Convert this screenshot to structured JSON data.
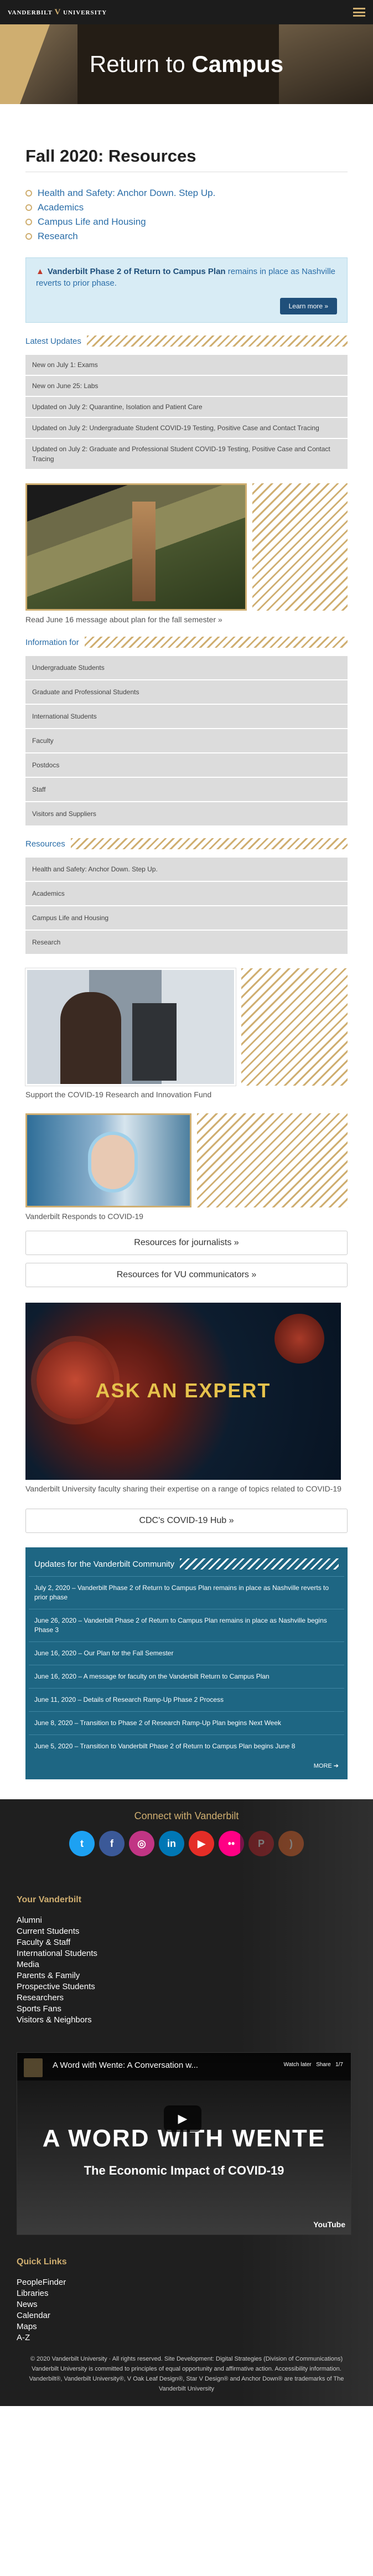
{
  "header": {
    "logo_word1": "VANDERBILT",
    "logo_mark": "V",
    "logo_word2": "UNIVERSITY",
    "menu_icon": "hamburger-icon"
  },
  "hero": {
    "title_light": "Return to",
    "title_bold": "Campus"
  },
  "page": {
    "title": "Fall 2020: Resources"
  },
  "resource_links": [
    "Health and Safety: Anchor Down. Step Up.",
    "Academics",
    "Campus Life and Housing",
    "Research"
  ],
  "alert": {
    "bold": "Vanderbilt Phase 2 of Return to Campus Plan",
    "text": " remains in place as Nashville reverts to prior phase.",
    "button": "Learn more »"
  },
  "latest": {
    "heading": "Latest Updates",
    "items": [
      "New on July 1: Exams",
      "New on June 25: Labs",
      "Updated on July 2: Quarantine, Isolation and Patient Care",
      "Updated on July 2: Undergraduate Student COVID-19 Testing, Positive Case and Contact Tracing",
      "Updated on July 2: Graduate and Professional Student COVID-19 Testing, Positive Case and Contact Tracing"
    ]
  },
  "feature1": {
    "caption": "Read June 16 message about plan for the fall semester »"
  },
  "info": {
    "heading": "Information for",
    "items": [
      "Undergraduate Students",
      "Graduate and Professional Students",
      "International Students",
      "Faculty",
      "Postdocs",
      "Staff",
      "Visitors and Suppliers"
    ]
  },
  "resources": {
    "heading": "Resources",
    "items": [
      "Health and Safety: Anchor Down. Step Up.",
      "Academics",
      "Campus Life and Housing",
      "Research"
    ]
  },
  "feature2": {
    "caption": "Support the COVID-19 Research and Innovation Fund"
  },
  "feature3": {
    "caption": "Vanderbilt Responds to COVID-19"
  },
  "buttons": {
    "journalists": "Resources for journalists »",
    "communicators": "Resources for VU communicators »"
  },
  "expert": {
    "title": "ASK AN EXPERT",
    "caption": "Vanderbilt University faculty sharing their expertise on a range of topics related to COVID-19"
  },
  "cdc": {
    "label": "CDC's COVID-19 Hub »"
  },
  "community": {
    "heading": "Updates for the Vanderbilt Community",
    "items": [
      "July 2, 2020 – Vanderbilt Phase 2 of Return to Campus Plan remains in place as Nashville reverts to prior phase",
      "June 26, 2020 – Vanderbilt Phase 2 of Return to Campus Plan remains in place as Nashville begins Phase 3",
      "June 16, 2020 – Our Plan for the Fall Semester",
      "June 16, 2020 – A message for faculty on the Vanderbilt Return to Campus Plan",
      "June 11, 2020 – Details of Research Ramp-Up Phase 2 Process",
      "June 8, 2020 – Transition to Phase 2 of Research Ramp-Up Plan begins Next Week",
      "June 5, 2020 – Transition to Vanderbilt Phase 2 of Return to Campus Plan begins June 8"
    ],
    "more": "MORE ➔"
  },
  "footer": {
    "connect": "Connect with Vanderbilt",
    "social": [
      {
        "name": "twitter-icon",
        "glyph": "t",
        "color": "#1da1f2"
      },
      {
        "name": "facebook-icon",
        "glyph": "f",
        "color": "#3b5998"
      },
      {
        "name": "instagram-icon",
        "glyph": "◎",
        "color": "#c13584"
      },
      {
        "name": "linkedin-icon",
        "glyph": "in",
        "color": "#0077b5"
      },
      {
        "name": "youtube-icon",
        "glyph": "▶",
        "color": "#e52d27"
      },
      {
        "name": "flickr-icon",
        "glyph": "••",
        "color": "#ff0084"
      },
      {
        "name": "pinterest-icon",
        "glyph": "P",
        "color": "#cb2027"
      },
      {
        "name": "rss-icon",
        "glyph": ")",
        "color": "#f26522"
      }
    ],
    "your_heading": "Your Vanderbilt",
    "your_links": [
      "Alumni",
      "Current Students",
      "Faculty & Staff",
      "International Students",
      "Media",
      "Parents & Family",
      "Prospective Students",
      "Researchers",
      "Sports Fans",
      "Visitors & Neighbors"
    ],
    "video": {
      "title": "A Word with Wente: A Conversation w...",
      "watch_later": "Watch later",
      "share": "Share",
      "page": "1/7",
      "big": "A WORD WITH WENTE",
      "sub": "The Economic Impact of COVID-19",
      "brand": "YouTube"
    },
    "quick_heading": "Quick Links",
    "quick_links": [
      "PeopleFinder",
      "Libraries",
      "News",
      "Calendar",
      "Maps",
      "A-Z"
    ],
    "copyright": "© 2020 Vanderbilt University · All rights reserved. Site Development: Digital Strategies (Division of Communications)",
    "eeo": "Vanderbilt University is committed to principles of equal opportunity and affirmative action. Accessibility information.",
    "tm": "Vanderbilt®, Vanderbilt University®, V Oak Leaf Design®, Star V Design® and Anchor Down® are trademarks of The Vanderbilt University"
  }
}
